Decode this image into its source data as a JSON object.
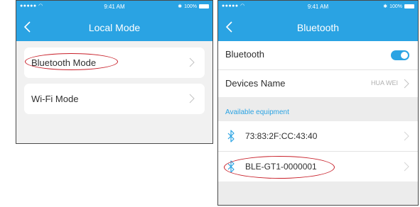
{
  "status": {
    "signal": "●●●●● ",
    "time": "9:41 AM",
    "bluetooth_glyph": "✱",
    "battery": "100%"
  },
  "local_mode": {
    "title": "Local Mode",
    "options": [
      {
        "label": "Bluetooth Mode"
      },
      {
        "label": "Wi-Fi Mode"
      }
    ]
  },
  "bluetooth": {
    "title": "Bluetooth",
    "toggle_label": "Bluetooth",
    "toggle_on": true,
    "devices_name_label": "Devices Name",
    "devices_name_value": "HUA WEI",
    "section_header": "Available equipment",
    "devices": [
      {
        "label": "73:83:2F:CC:43:40"
      },
      {
        "label": "BLE-GT1-0000001"
      }
    ]
  },
  "colors": {
    "accent": "#2aa3e3",
    "annotation": "#c81e28",
    "bluetooth_icon": "#2aa3e3"
  },
  "icons": [
    "back-icon",
    "chevron-right-icon",
    "bluetooth-icon",
    "battery-icon",
    "wifi-icon"
  ]
}
